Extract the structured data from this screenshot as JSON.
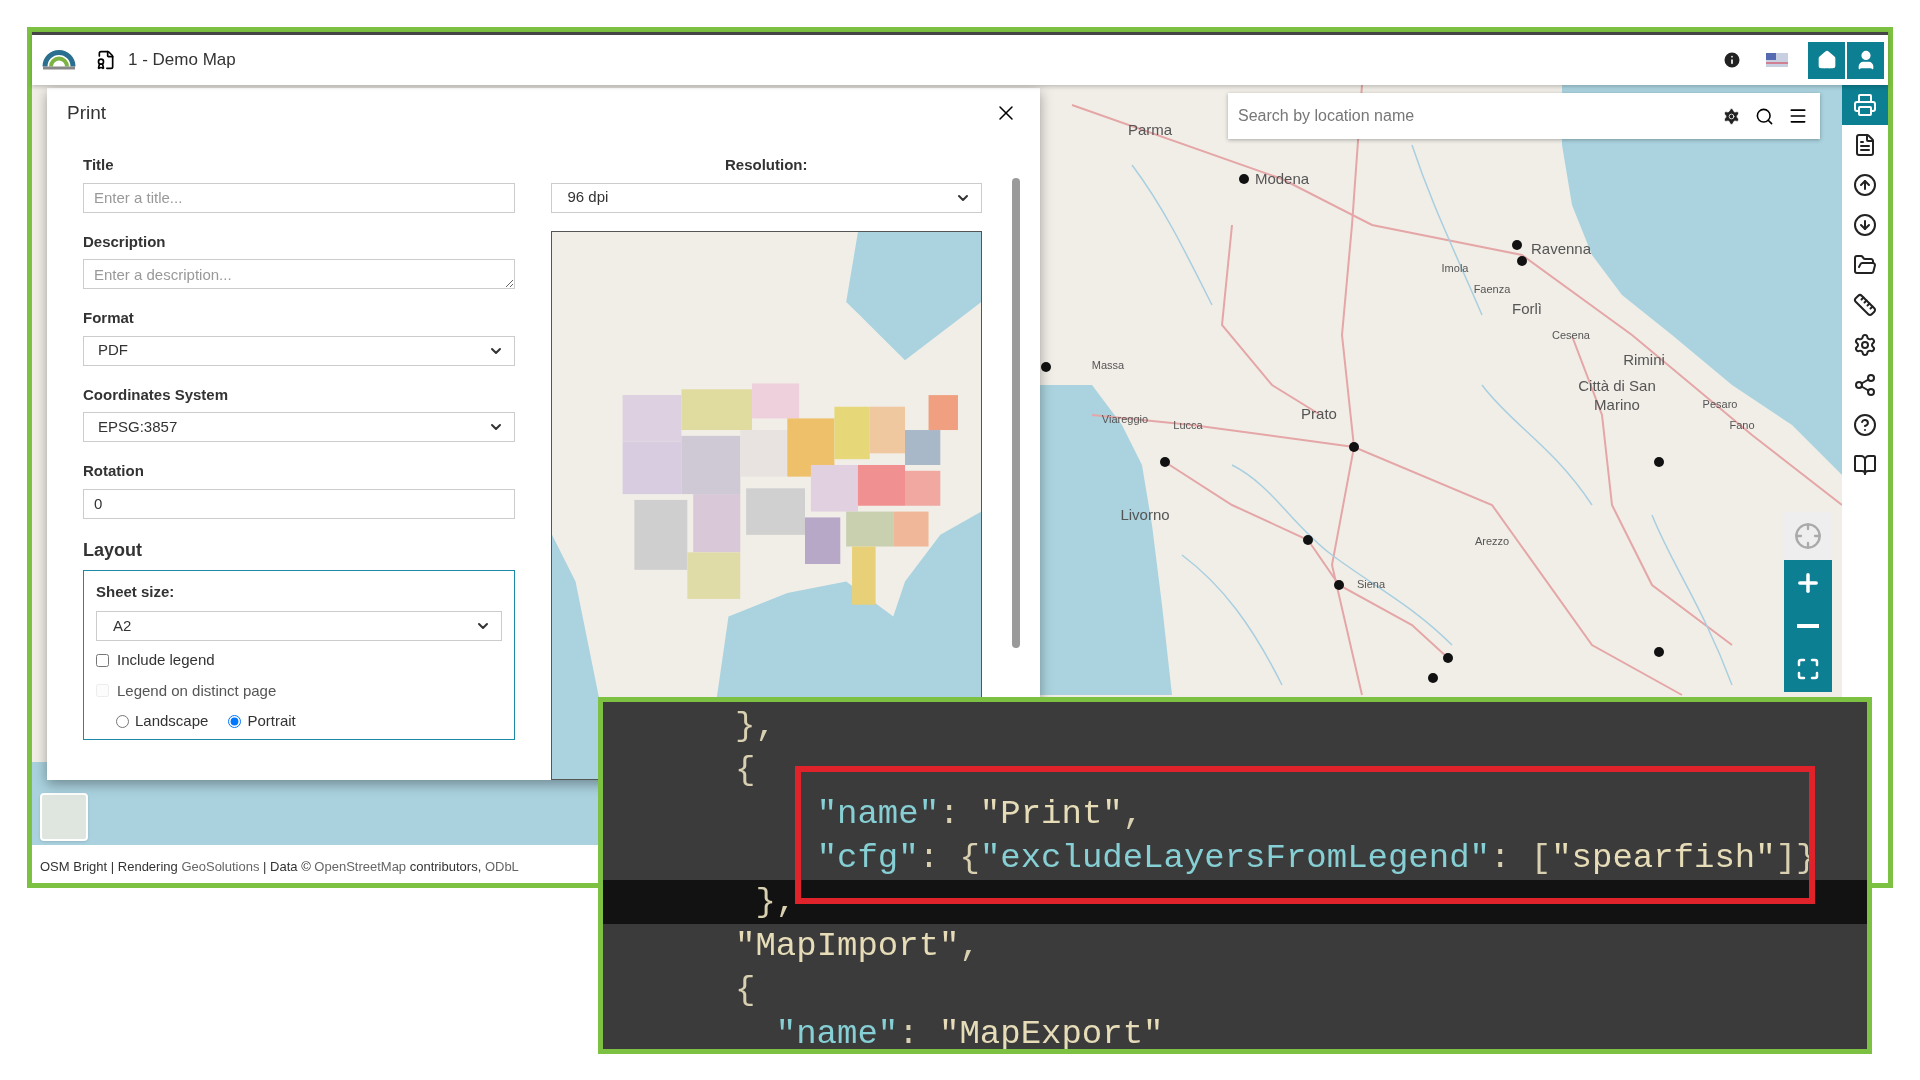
{
  "header": {
    "title": "1 - Demo Map"
  },
  "search": {
    "placeholder": "Search by location name"
  },
  "toolbar": [
    {
      "selected": true
    },
    {
      "selected": false
    },
    {
      "selected": false
    },
    {
      "selected": false
    },
    {
      "selected": false
    },
    {
      "selected": false
    },
    {
      "selected": false
    },
    {
      "selected": false
    },
    {
      "selected": false
    },
    {
      "selected": false
    }
  ],
  "print_dialog": {
    "title": "Print",
    "fields": [
      {
        "kind": "text",
        "label": "Title",
        "placeholder": "Enter a title..."
      },
      {
        "kind": "textarea",
        "label": "Description",
        "placeholder": "Enter a description..."
      },
      {
        "kind": "select",
        "label": "Format",
        "value": "PDF"
      },
      {
        "kind": "select",
        "label": "Coordinates System",
        "value": "EPSG:3857"
      },
      {
        "kind": "text",
        "label": "Rotation",
        "value": "0"
      }
    ],
    "resolution": {
      "label": "Resolution:",
      "value": "96 dpi"
    },
    "layout": {
      "title": "Layout",
      "sheet_size": {
        "label": "Sheet size:",
        "value": "A2"
      },
      "checkboxes": [
        {
          "label": "Include legend",
          "checked": false,
          "disabled": false
        },
        {
          "label": "Legend on distinct page",
          "checked": false,
          "disabled": true
        }
      ],
      "orientation": [
        {
          "label": "Landscape",
          "selected": false
        },
        {
          "label": "Portrait",
          "selected": true
        }
      ]
    }
  },
  "map_labels": [
    {
      "text": "Parma",
      "kind": "city"
    },
    {
      "text": "Modena",
      "kind": "city"
    },
    {
      "text": "Ravenna",
      "kind": "city"
    },
    {
      "text": "Imola",
      "kind": "town"
    },
    {
      "text": "Faenza",
      "kind": "town"
    },
    {
      "text": "Forlì",
      "kind": "city"
    },
    {
      "text": "Cesena",
      "kind": "town"
    },
    {
      "text": "Rimini",
      "kind": "city"
    },
    {
      "text": "Città di San Marino",
      "kind": "city"
    },
    {
      "text": "Pesaro",
      "kind": "town"
    },
    {
      "text": "Fano",
      "kind": "town"
    },
    {
      "text": "Massa",
      "kind": "town"
    },
    {
      "text": "Viareggio",
      "kind": "town"
    },
    {
      "text": "Lucca",
      "kind": "town"
    },
    {
      "text": "Prato",
      "kind": "city"
    },
    {
      "text": "Livorno",
      "kind": "city"
    },
    {
      "text": "Arezzo",
      "kind": "town"
    },
    {
      "text": "Siena",
      "kind": "town"
    }
  ],
  "attribution": [
    {
      "text": "OSM Bright | Rendering ",
      "link": false
    },
    {
      "text": "GeoSolutions",
      "link": true
    },
    {
      "text": " | Data © ",
      "link": false
    },
    {
      "text": "OpenStreetMap",
      "link": true
    },
    {
      "text": " contributors, ",
      "link": false
    },
    {
      "text": "ODbL",
      "link": true
    }
  ],
  "code": [
    {
      "current": false,
      "tokens": [
        {
          "text": "},",
          "kind": "punct"
        }
      ]
    },
    {
      "current": false,
      "tokens": [
        {
          "text": "{",
          "kind": "punct"
        }
      ]
    },
    {
      "current": false,
      "tokens": [
        {
          "text": "\"name\"",
          "kind": "key"
        },
        {
          "text": ": ",
          "kind": "punct"
        },
        {
          "text": "\"Print\"",
          "kind": "string"
        },
        {
          "text": ",",
          "kind": "punct"
        }
      ]
    },
    {
      "current": false,
      "tokens": [
        {
          "text": "\"cfg\"",
          "kind": "key"
        },
        {
          "text": ": {",
          "kind": "punct"
        },
        {
          "text": "\"excludeLayersFromLegend\"",
          "kind": "key"
        },
        {
          "text": ": [",
          "kind": "punct"
        },
        {
          "text": "\"spearfish\"",
          "kind": "string"
        },
        {
          "text": "]}",
          "kind": "punct"
        }
      ]
    },
    {
      "current": true,
      "tokens": [
        {
          "text": "},",
          "kind": "punct"
        }
      ]
    },
    {
      "current": false,
      "tokens": [
        {
          "text": "\"MapImport\"",
          "kind": "string"
        },
        {
          "text": ",",
          "kind": "punct"
        }
      ]
    },
    {
      "current": false,
      "tokens": [
        {
          "text": "{",
          "kind": "punct"
        }
      ]
    },
    {
      "current": false,
      "tokens": [
        {
          "text": "\"name\"",
          "kind": "key"
        },
        {
          "text": ": ",
          "kind": "punct"
        },
        {
          "text": "\"MapExport\"",
          "kind": "string"
        }
      ]
    }
  ]
}
